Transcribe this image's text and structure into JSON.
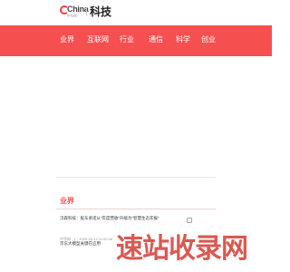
{
  "header": {
    "logo_word": "China",
    "logo_sub": "中华网",
    "section_title": "科技"
  },
  "nav": {
    "items": [
      {
        "label": "业界"
      },
      {
        "label": "互联网"
      },
      {
        "label": "行业"
      },
      {
        "label": "通信"
      },
      {
        "label": "科学"
      },
      {
        "label": "创业"
      }
    ]
  },
  "list": {
    "heading": "业界",
    "articles": [
      {
        "title": "汉森科技：股东承诺从“年度营收”升级为“智慧生态年报”",
        "meta": "中华网 · 1 · 2025-03-12 11:59:46"
      },
      {
        "title": "京东大模型关键在应用",
        "meta": ""
      }
    ]
  },
  "watermark": {
    "text": "速站收录网"
  },
  "colors": {
    "accent": "#f64f4f",
    "watermark": "#d43c35"
  }
}
